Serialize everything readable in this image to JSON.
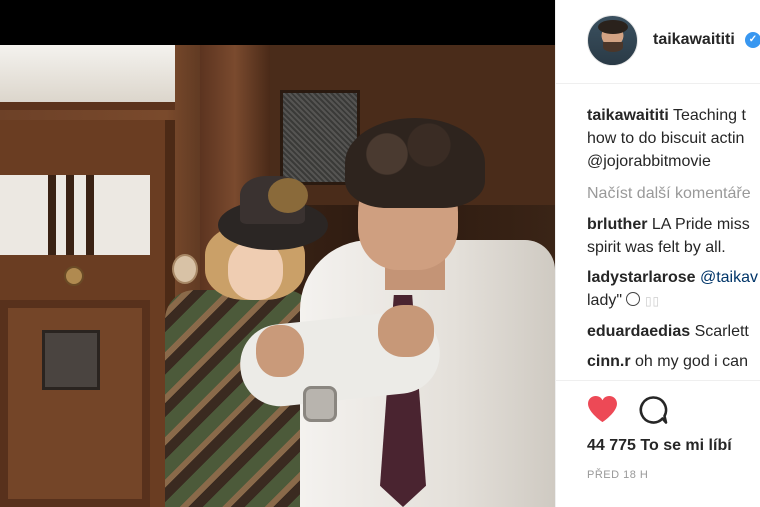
{
  "post": {
    "username": "taikawaititi",
    "verified_icon": "verified-badge-icon",
    "accent_color": "#3897f0"
  },
  "comments": {
    "caption": {
      "user": "taikawaititi",
      "line1": "Teaching t",
      "line2": "how to do biscuit actin",
      "line3": "@jojorabbitmovie"
    },
    "load_more": "Načíst další komentáře",
    "items": [
      {
        "user": "brluther",
        "line1": "LA Pride miss",
        "line2": "spirit was felt by all."
      },
      {
        "user": "ladystarlarose",
        "line1": "@taikav",
        "line2": "lady\""
      },
      {
        "user": "eduardaedias",
        "line1": "Scarlett"
      },
      {
        "user": "cinn.r",
        "line1": "oh my god i can"
      }
    ]
  },
  "actions": {
    "like_icon": "heart-icon",
    "like_color": "#ed4956",
    "comment_icon": "comment-bubble-icon",
    "likes_text": "44 775 To se mi líbí",
    "timestamp": "PŘED 18 H"
  }
}
